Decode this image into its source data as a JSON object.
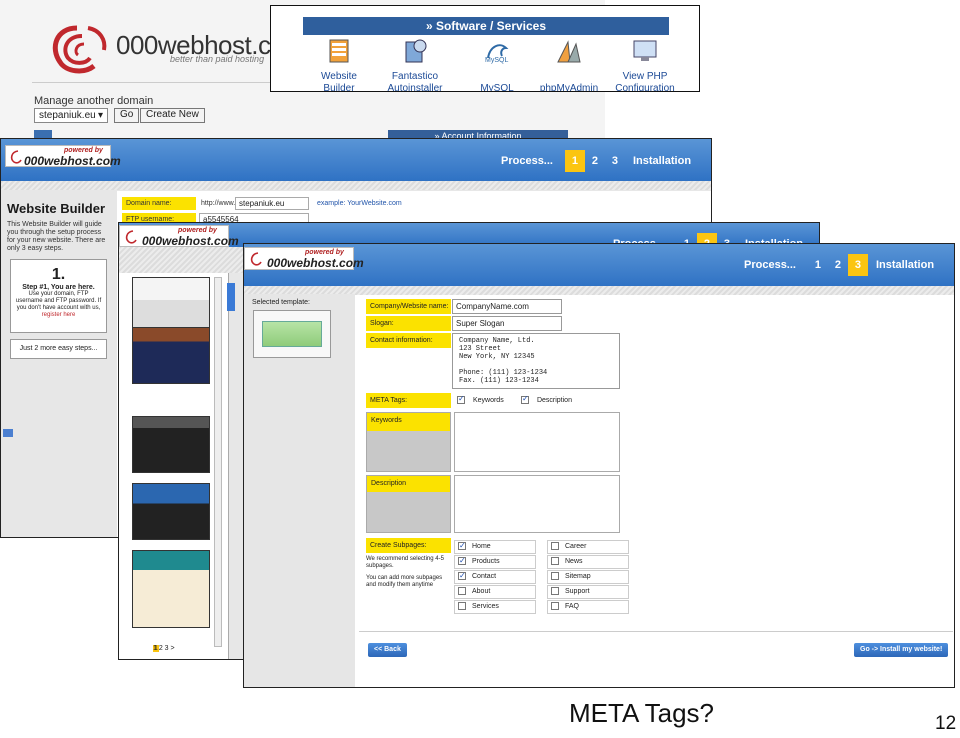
{
  "control_panel": {
    "brand": "000webhost.com",
    "tagline": "better than paid hosting",
    "manage_label": "Manage another domain",
    "domain_select": "stepaniuk.eu",
    "go_button": "Go",
    "create_button": "Create New",
    "account_bar": "» Account Information"
  },
  "services": {
    "heading": "» Software / Services",
    "items": [
      {
        "line1": "Website",
        "line2": "Builder",
        "icon": "website-builder-icon"
      },
      {
        "line1": "Fantastico",
        "line2": "Autoinstaller",
        "icon": "fantastico-icon"
      },
      {
        "line1": "",
        "line2": "MySQL",
        "icon": "mysql-icon"
      },
      {
        "line1": "",
        "line2": "phpMyAdmin",
        "icon": "phpmyadmin-icon"
      },
      {
        "line1": "View PHP",
        "line2": "Configuration",
        "icon": "php-config-icon"
      }
    ]
  },
  "logo": {
    "powered_by": "powered by",
    "text": "000webhost.com"
  },
  "stepbar": {
    "process": "Process...",
    "steps": [
      "1",
      "2",
      "3"
    ],
    "install": "Installation"
  },
  "builder_step1": {
    "title": "Website Builder",
    "intro": "This Website Builder will guide you through the setup process for your new website. There are only 3 easy steps.",
    "step_num": "1.",
    "step_title": "Step #1, You are here.",
    "step_text": "Use your domain, FTP username and FTP password. If you don't have account with us,",
    "register_link": "register here",
    "more_steps": "Just 2 more easy steps...",
    "domain_label": "Domain name:",
    "domain_prefix": "http://www.",
    "domain_value": "stepaniuk.eu",
    "domain_example": "example: YourWebsite.com",
    "ftp_label": "FTP username:",
    "ftp_value": "a5545564"
  },
  "templates": {
    "pager": "1 2 3 >",
    "current_page": "1"
  },
  "install_step3": {
    "selected_template_label": "Selected template:",
    "company_label": "Company/Website name:",
    "company_value": "CompanyName.com",
    "slogan_label": "Slogan:",
    "slogan_value": "Super Slogan",
    "contact_label": "Contact information:",
    "contact_lines": [
      "Company Name, Ltd.",
      "123 Street",
      "New York, NY 12345",
      "",
      "Phone: (111) 123-1234",
      "Fax. (111) 123-1234"
    ],
    "meta_label": "META Tags:",
    "meta_keywords": "Keywords",
    "meta_description": "Description",
    "keywords_box": "Keywords",
    "description_box": "Description",
    "subpages_label": "Create Subpages:",
    "subpages_note1": "We recommend selecting 4-5 subpages.",
    "subpages_note2": "You can add more subpages and modify them anytime",
    "subpages_left": [
      {
        "label": "Home",
        "checked": true
      },
      {
        "label": "Products",
        "checked": true
      },
      {
        "label": "Contact",
        "checked": true
      },
      {
        "label": "About",
        "checked": false
      },
      {
        "label": "Services",
        "checked": false
      }
    ],
    "subpages_right": [
      {
        "label": "Career",
        "checked": false
      },
      {
        "label": "News",
        "checked": false
      },
      {
        "label": "Sitemap",
        "checked": false
      },
      {
        "label": "Support",
        "checked": false
      },
      {
        "label": "FAQ",
        "checked": false
      }
    ],
    "back_button": "<< Back",
    "install_button": "Go -> Install my website!"
  },
  "slide": {
    "caption": "META Tags?",
    "page": "12"
  }
}
